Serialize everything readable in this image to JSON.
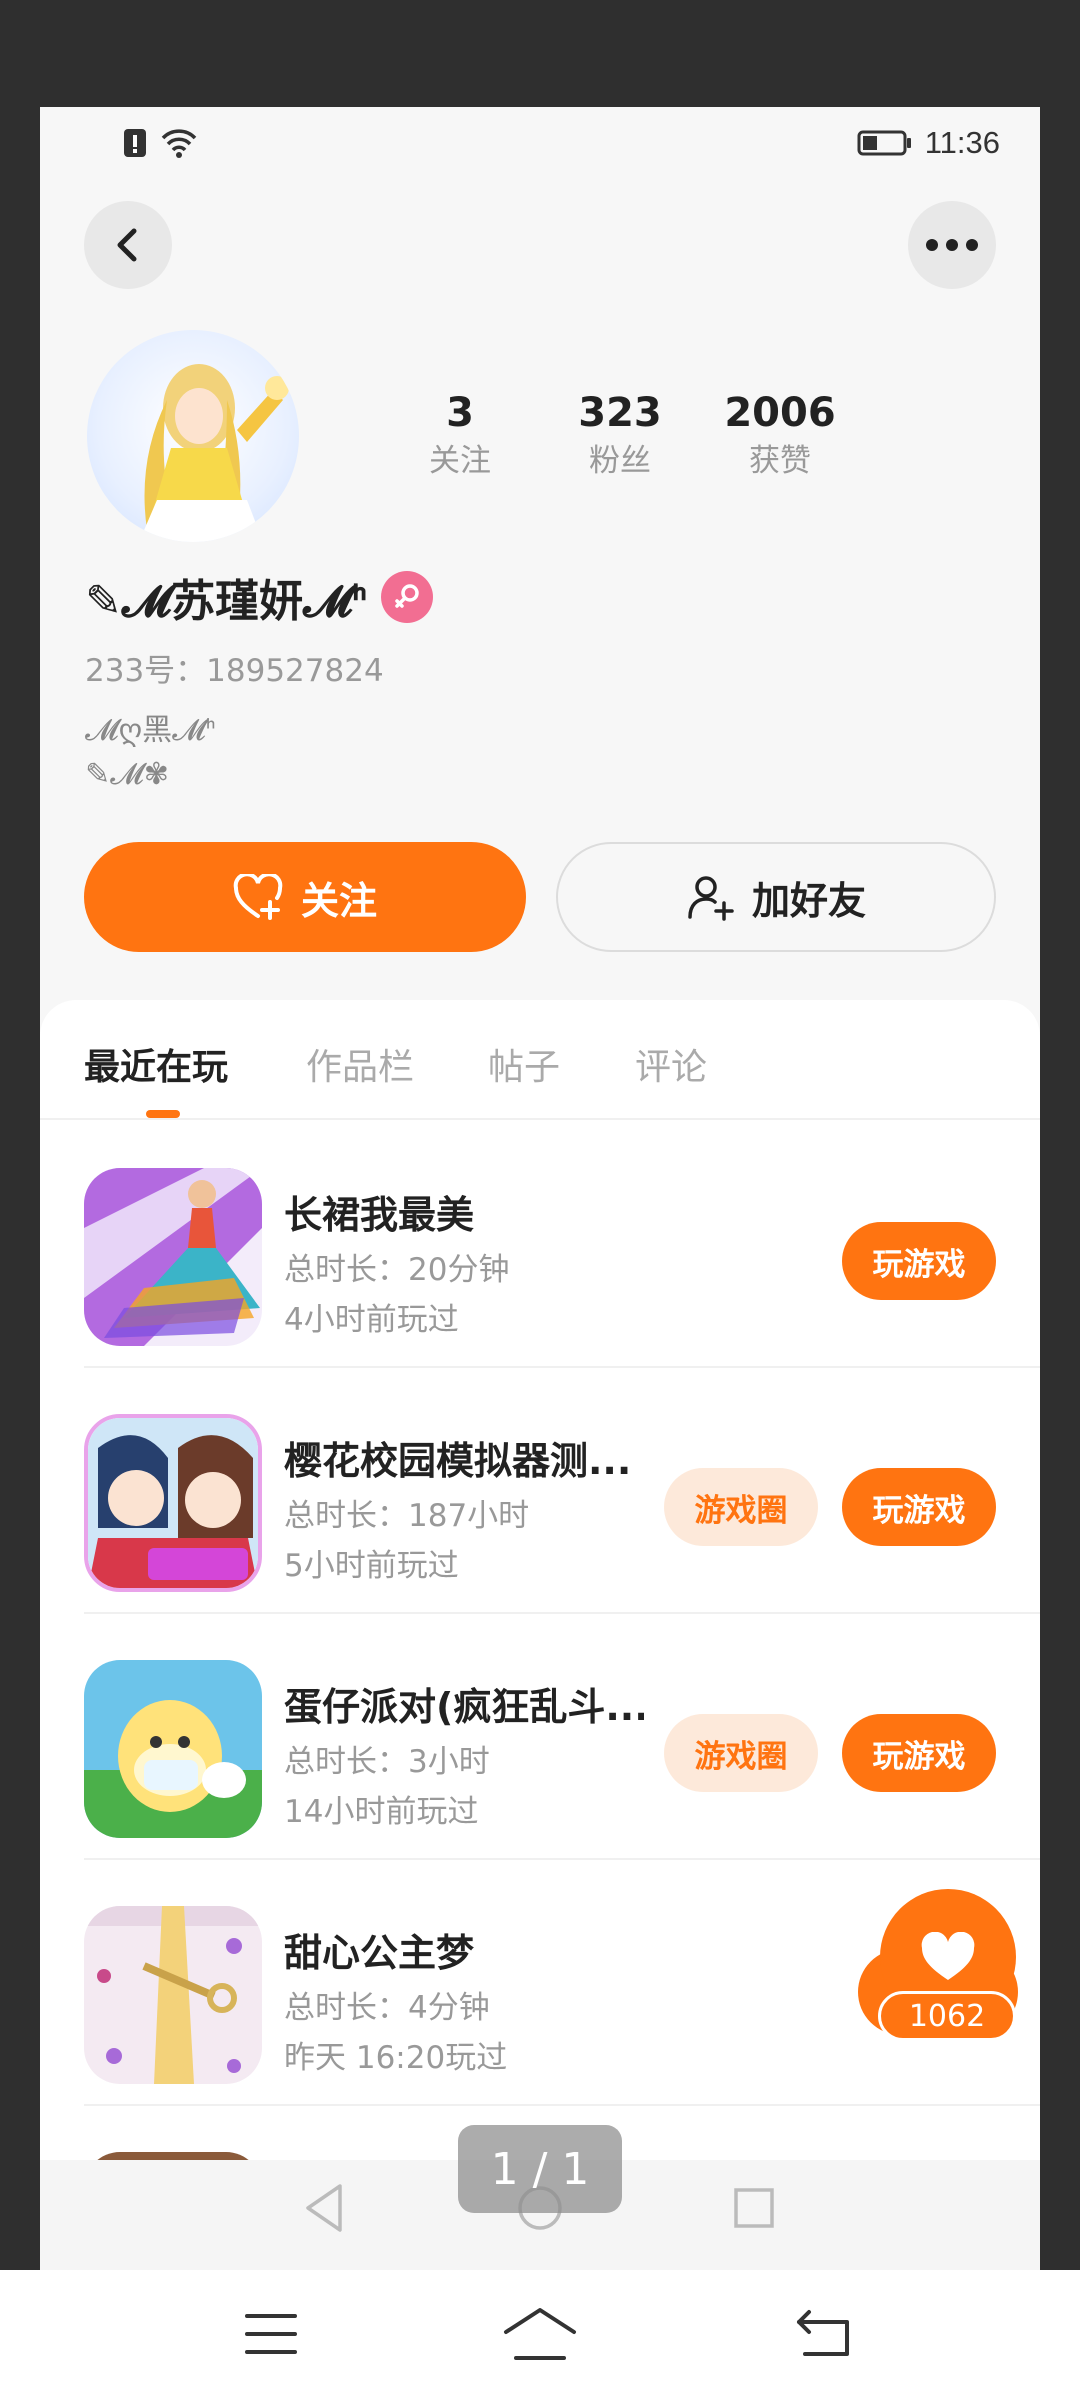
{
  "status_bar": {
    "time": "11:36",
    "icons": [
      "alert-sim-icon",
      "wifi-icon",
      "battery-icon"
    ]
  },
  "header": {
    "back_icon": "chevron-left-icon",
    "more_icon": "more-dots-icon"
  },
  "profile": {
    "nickname": "✎𝓜苏瑾妍𝓜ᑋ",
    "gender_icon": "female-icon",
    "uid": "233号：189527824",
    "bio_line1": "𝓜ღ黑𝓜ᑋ",
    "bio_line2": "✎𝓜✾",
    "stats": [
      {
        "value": "3",
        "label": "关注"
      },
      {
        "value": "323",
        "label": "粉丝"
      },
      {
        "value": "2006",
        "label": "获赞"
      }
    ],
    "follow_label": "关注",
    "add_friend_label": "加好友"
  },
  "tabs": [
    {
      "label": "最近在玩",
      "active": true
    },
    {
      "label": "作品栏",
      "active": false
    },
    {
      "label": "帖子",
      "active": false
    },
    {
      "label": "评论",
      "active": false
    }
  ],
  "games": [
    {
      "title": "长裙我最美",
      "duration": "总时长：20分钟",
      "last_played": "4小时前玩过",
      "has_circle": false,
      "play_label": "玩游戏",
      "circle_label": ""
    },
    {
      "title": "樱花校园模拟器测...",
      "duration": "总时长：187小时",
      "last_played": "5小时前玩过",
      "has_circle": true,
      "play_label": "玩游戏",
      "circle_label": "游戏圈"
    },
    {
      "title": "蛋仔派对(疯狂乱斗...",
      "duration": "总时长：3小时",
      "last_played": "14小时前玩过",
      "has_circle": true,
      "play_label": "玩游戏",
      "circle_label": "游戏圈"
    },
    {
      "title": "甜心公主梦",
      "duration": "总时长：4分钟",
      "last_played": "昨天 16:20玩过",
      "has_circle": false,
      "play_label": "",
      "circle_label": ""
    }
  ],
  "like_bubble": {
    "count": "1062"
  },
  "page_indicator": "1 / 1",
  "colors": {
    "accent": "#ff7411",
    "accent_light": "#fde9da",
    "female": "#f26e92"
  }
}
